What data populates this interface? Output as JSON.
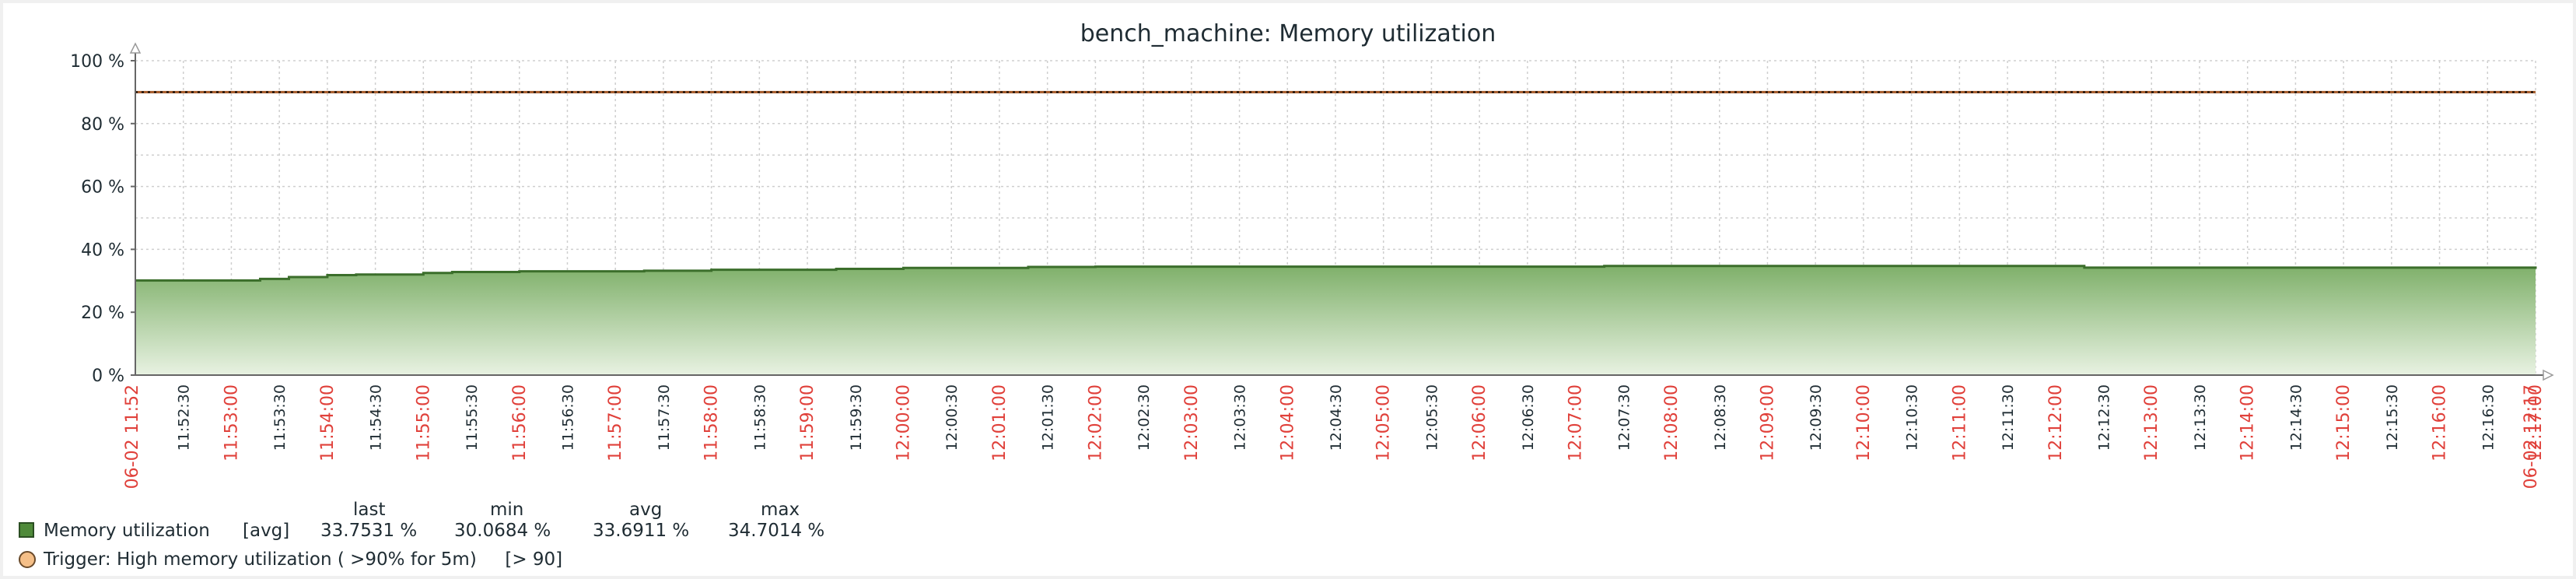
{
  "chart_data": {
    "type": "area",
    "title": "bench_machine: Memory utilization",
    "y_ticks": [
      "100 %",
      "80 %",
      "60 %",
      "40 %",
      "20 %",
      "0 %"
    ],
    "ylim": [
      0,
      100
    ],
    "grid": true,
    "x_start_label": "06-02 11:52",
    "x_end_label": "06-02 12:17",
    "x_tick_labels": [
      "11:52:30",
      "11:53:00",
      "11:53:30",
      "11:54:00",
      "11:54:30",
      "11:55:00",
      "11:55:30",
      "11:56:00",
      "11:56:30",
      "11:57:00",
      "11:57:30",
      "11:58:00",
      "11:58:30",
      "11:59:00",
      "11:59:30",
      "12:00:00",
      "12:00:30",
      "12:01:00",
      "12:01:30",
      "12:02:00",
      "12:02:30",
      "12:03:00",
      "12:03:30",
      "12:04:00",
      "12:04:30",
      "12:05:00",
      "12:05:30",
      "12:06:00",
      "12:06:30",
      "12:07:00",
      "12:07:30",
      "12:08:00",
      "12:08:30",
      "12:09:00",
      "12:09:30",
      "12:10:00",
      "12:10:30",
      "12:11:00",
      "12:11:30",
      "12:12:00",
      "12:12:30",
      "12:13:00",
      "12:13:30",
      "12:14:00",
      "12:14:30",
      "12:15:00",
      "12:15:30",
      "12:16:00",
      "12:16:30",
      "12:17:00"
    ],
    "series": [
      {
        "name": "Memory utilization",
        "x_minutes": [
          0,
          1.0,
          1.3,
          1.6,
          2.0,
          2.3,
          3.0,
          3.3,
          4.0,
          5.3,
          6.0,
          7.3,
          8.0,
          9.3,
          10.0,
          15.0,
          15.3,
          20.0,
          20.3,
          25.0,
          25.3,
          27.3,
          28.0
        ],
        "y": [
          30.1,
          30.1,
          30.6,
          31.2,
          31.8,
          32.0,
          32.5,
          32.8,
          33.0,
          33.2,
          33.5,
          33.8,
          34.1,
          34.4,
          34.5,
          34.5,
          34.7,
          34.7,
          34.2,
          34.2,
          33.8,
          33.8,
          33.8
        ],
        "color": "#4f8a3a"
      }
    ],
    "threshold": {
      "value": 90,
      "color": "#a65a28"
    },
    "x_span_minutes": 25.0
  },
  "legend": {
    "headers": {
      "last": "last",
      "min": "min",
      "avg": "avg",
      "max": "max"
    },
    "item": {
      "name": "Memory utilization",
      "func": "[avg]",
      "last": "33.7531 %",
      "min": "30.0684 %",
      "avg": "33.6911 %",
      "max": "34.7014 %"
    },
    "trigger": "Trigger: High memory utilization ( >90% for 5m)     [> 90]"
  }
}
